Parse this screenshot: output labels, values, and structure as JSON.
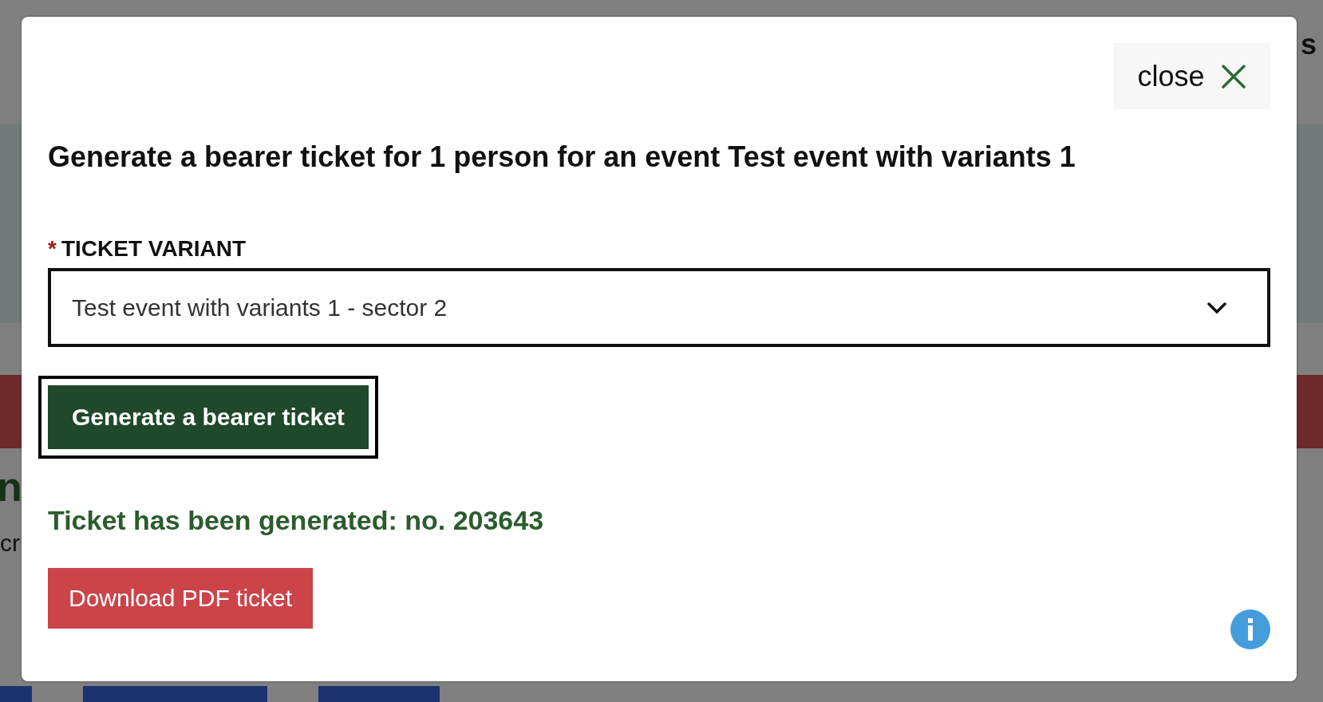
{
  "background_page": {
    "header_fragment": "s",
    "heading_fragment": "n",
    "text_fragment": "cr"
  },
  "dialog": {
    "close_button": {
      "label": "close"
    },
    "title": "Generate a bearer ticket for 1 person for an event Test event with variants 1",
    "field": {
      "required": true,
      "required_mark": "*",
      "label": "TICKET VARIANT",
      "value": "Test event with variants 1 - sector 2"
    },
    "generate_button": {
      "label": "Generate a bearer ticket",
      "focused": true
    },
    "success_message": "Ticket has been generated: no. 203643",
    "download_button": {
      "label": "Download PDF ticket"
    }
  }
}
